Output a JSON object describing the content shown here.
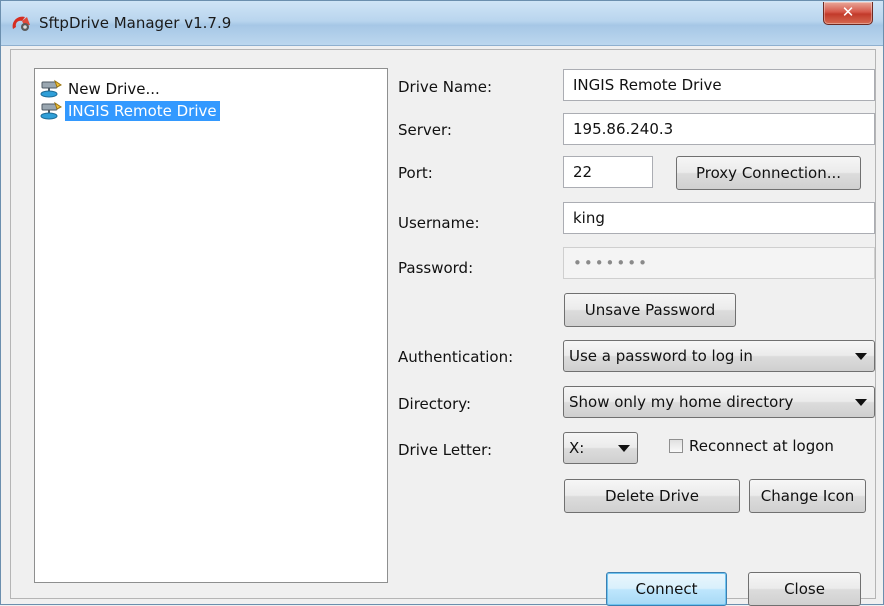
{
  "window": {
    "title": "SftpDrive Manager v1.7.9",
    "close_glyph": "✕"
  },
  "tree": {
    "items": [
      {
        "label": "New Drive...",
        "selected": false
      },
      {
        "label": "INGIS Remote Drive",
        "selected": true
      }
    ]
  },
  "form": {
    "drive_name": {
      "label": "Drive Name:",
      "value": "INGIS Remote Drive"
    },
    "server": {
      "label": "Server:",
      "value": "195.86.240.3"
    },
    "port": {
      "label": "Port:",
      "value": "22"
    },
    "proxy_button": "Proxy Connection...",
    "username": {
      "label": "Username:",
      "value": "king"
    },
    "password": {
      "label": "Password:",
      "value": "•••••••"
    },
    "unsave_password_button": "Unsave Password",
    "authentication": {
      "label": "Authentication:",
      "value": "Use a password to log in"
    },
    "directory": {
      "label": "Directory:",
      "value": "Show only my home directory"
    },
    "drive_letter": {
      "label": "Drive Letter:",
      "value": "X:"
    },
    "reconnect": {
      "label": "Reconnect at logon",
      "checked": false
    },
    "delete_drive_button": "Delete Drive",
    "change_icon_button": "Change Icon",
    "connect_button": "Connect",
    "close_button": "Close"
  },
  "icons": {
    "app": "sftpdrive-app-icon",
    "drive": "network-drive-icon"
  },
  "colors": {
    "selection": "#3399ff",
    "titlebar": "#b9d5ee",
    "close": "#c23a2a"
  }
}
